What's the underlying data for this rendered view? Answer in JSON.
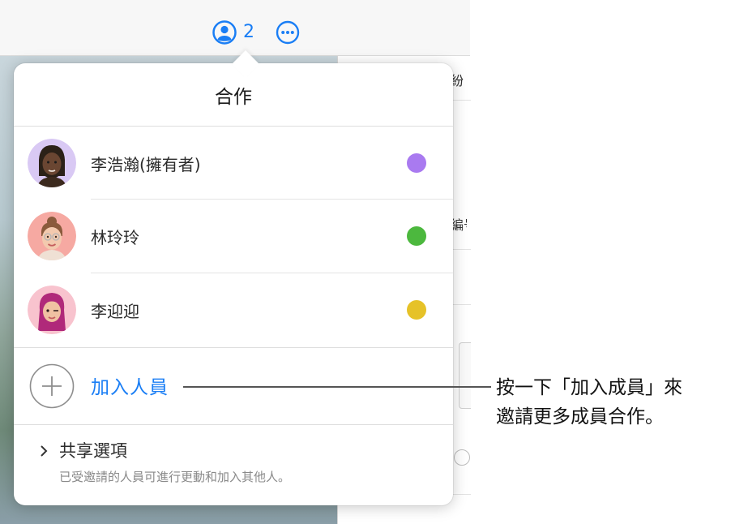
{
  "toolbar": {
    "collaborator_count": "2",
    "collaborate_icon": "person-circle-icon",
    "more_icon": "ellipsis-circle-icon",
    "accent_color": "#1a7ef5"
  },
  "background": {
    "right_panel_text_1": "紛",
    "right_panel_text_2": "編号"
  },
  "popover": {
    "title": "合作",
    "members": [
      {
        "name": "李浩瀚(擁有者)",
        "color": "#a97af0",
        "avatar": "memoji-avatar"
      },
      {
        "name": "林玲玲",
        "color": "#4cb83e",
        "avatar": "memoji-avatar"
      },
      {
        "name": "李迎迎",
        "color": "#e6c228",
        "avatar": "memoji-avatar"
      }
    ],
    "add_people_label": "加入人員",
    "add_icon": "plus-circle-icon",
    "share_options": {
      "title": "共享選項",
      "description": "已受邀請的人員可進行更動和加入其他人。",
      "chevron_icon": "chevron-right-icon"
    }
  },
  "callout": {
    "line1": "按一下「加入成員」來",
    "line2": "邀請更多成員合作。"
  }
}
